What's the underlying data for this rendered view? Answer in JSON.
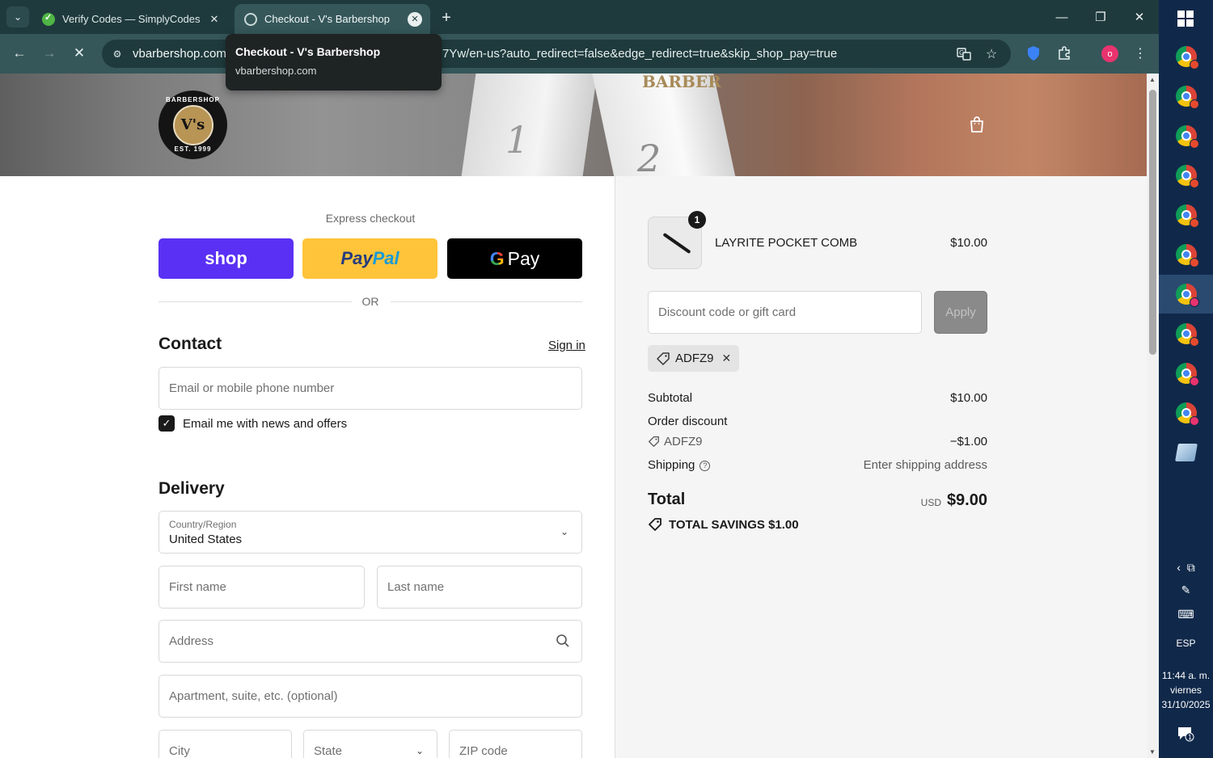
{
  "browser": {
    "tabs": [
      {
        "title": "Verify Codes — SimplyCodes",
        "close": "✕"
      },
      {
        "title": "Checkout - V's Barbershop",
        "close": "✕"
      }
    ],
    "new_tab": "+",
    "url_host": "vbarbershop.com,",
    "url_rest": "7Yw/en-us?auto_redirect=false&edge_redirect=true&skip_shop_pay=true",
    "tooltip": {
      "title": "Checkout - V's Barbershop",
      "subtitle": "vbarbershop.com"
    },
    "profile_initial": "o",
    "icons": {
      "back": "back-arrow-icon",
      "forward": "forward-arrow-icon",
      "stop": "stop-loading-icon",
      "translate": "translate-icon",
      "bookmark": "star-icon",
      "shield": "shield-icon",
      "extensions": "puzzle-icon",
      "menu": "kebab-menu-icon"
    }
  },
  "header": {
    "logo": {
      "top": "BARBERSHOP",
      "middle": "V's",
      "bottom": "EST. 1999"
    },
    "hero_text": {
      "brand": "BARBER",
      "num1": "1",
      "num2": "2"
    }
  },
  "checkout": {
    "express_label": "Express checkout",
    "buttons": {
      "shop": "shop",
      "paypal_a": "Pay",
      "paypal_b": "Pal",
      "gpay_g": "G",
      "gpay": "Pay"
    },
    "or": "OR",
    "contact": {
      "title": "Contact",
      "signin": "Sign in",
      "email_placeholder": "Email or mobile phone number",
      "newsletter_label": "Email me with news and offers",
      "newsletter_checked": true
    },
    "delivery": {
      "title": "Delivery",
      "country_label": "Country/Region",
      "country_value": "United States",
      "first_name": "First name",
      "last_name": "Last name",
      "address": "Address",
      "apartment": "Apartment, suite, etc. (optional)",
      "city": "City",
      "state": "State",
      "zip": "ZIP code"
    }
  },
  "summary": {
    "item": {
      "name": "LAYRITE POCKET COMB",
      "price": "$10.00",
      "qty": "1"
    },
    "discount_placeholder": "Discount code or gift card",
    "apply": "Apply",
    "applied_code": "ADFZ9",
    "subtotal_label": "Subtotal",
    "subtotal_value": "$10.00",
    "order_discount_label": "Order discount",
    "discount_code": "ADFZ9",
    "discount_value": "−$1.00",
    "shipping_label": "Shipping",
    "shipping_value": "Enter shipping address",
    "total_label": "Total",
    "total_currency": "USD",
    "total_value": "$9.00",
    "savings_label": "TOTAL SAVINGS",
    "savings_value": "$1.00"
  },
  "taskbar": {
    "lang": "ESP",
    "time": "11:44 a. m.",
    "day": "viernes",
    "date": "31/10/2025",
    "notif_count": "1"
  }
}
